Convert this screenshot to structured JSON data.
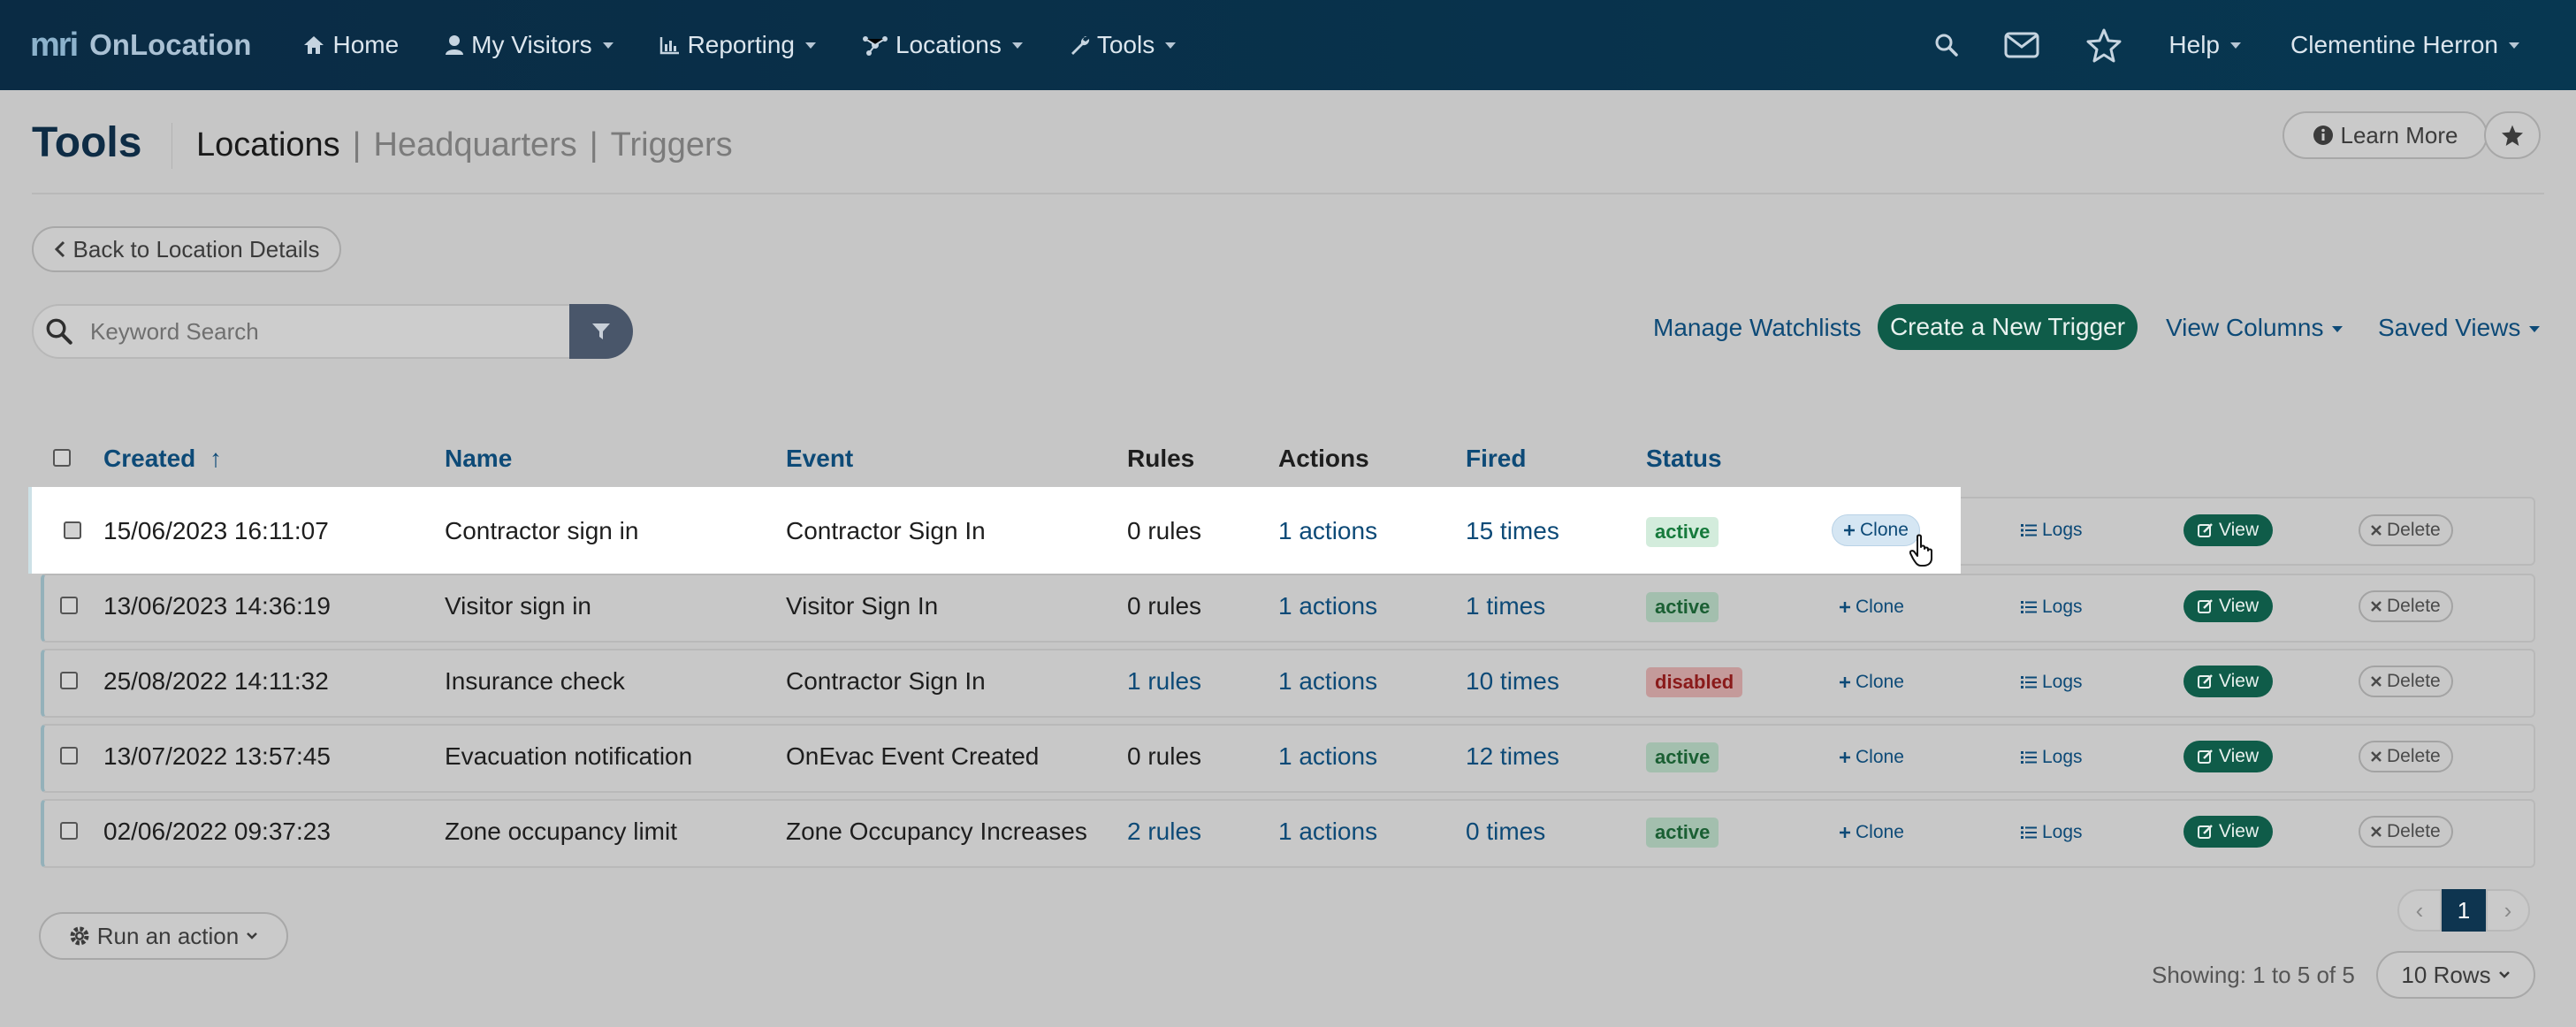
{
  "nav": {
    "logo_mark": "mri",
    "logo_text": "OnLocation",
    "items": [
      {
        "label": "Home",
        "icon": "home-icon"
      },
      {
        "label": "My Visitors",
        "icon": "user-icon"
      },
      {
        "label": "Reporting",
        "icon": "chart-icon"
      },
      {
        "label": "Locations",
        "icon": "locations-icon"
      },
      {
        "label": "Tools",
        "icon": "wrench-icon"
      }
    ],
    "help_label": "Help",
    "user_name": "Clementine Herron"
  },
  "header": {
    "title": "Tools",
    "tabs": [
      "Locations",
      "Headquarters",
      "Triggers"
    ],
    "tab_separator": "|",
    "learn_more": "Learn More"
  },
  "toolbar": {
    "back_label": "Back to Location Details",
    "search_placeholder": "Keyword Search",
    "manage_watchlists": "Manage Watchlists",
    "create_trigger": "Create a New Trigger",
    "view_columns": "View Columns",
    "saved_views": "Saved Views"
  },
  "table": {
    "columns": {
      "created": "Created",
      "sort_indicator": "↑",
      "name": "Name",
      "event": "Event",
      "rules": "Rules",
      "actions": "Actions",
      "fired": "Fired",
      "status": "Status"
    },
    "row_actions": {
      "clone": "Clone",
      "logs": "Logs",
      "view": "View",
      "delete": "Delete"
    },
    "rows": [
      {
        "created": "15/06/2023 16:11:07",
        "name": "Contractor sign in",
        "event": "Contractor Sign In",
        "rules": "0 rules",
        "actions": "1 actions",
        "fired": "15 times",
        "status": "active"
      },
      {
        "created": "13/06/2023 14:36:19",
        "name": "Visitor sign in",
        "event": "Visitor Sign In",
        "rules": "0 rules",
        "actions": "1 actions",
        "fired": "1 times",
        "status": "active"
      },
      {
        "created": "25/08/2022 14:11:32",
        "name": "Insurance check",
        "event": "Contractor Sign In",
        "rules": "1 rules",
        "actions": "1 actions",
        "fired": "10 times",
        "status": "disabled"
      },
      {
        "created": "13/07/2022 13:57:45",
        "name": "Evacuation notification",
        "event": "OnEvac Event Created",
        "rules": "0 rules",
        "actions": "1 actions",
        "fired": "12 times",
        "status": "active"
      },
      {
        "created": "02/06/2022 09:37:23",
        "name": "Zone occupancy limit",
        "event": "Zone Occupancy Increases",
        "rules": "2 rules",
        "actions": "1 actions",
        "fired": "0 times",
        "status": "active"
      }
    ]
  },
  "footer": {
    "run_action": "Run an action",
    "pagination": {
      "prev": "‹",
      "current": "1",
      "next": "›"
    },
    "showing": "Showing: 1 to 5 of 5",
    "rows_per_page": "10 Rows"
  }
}
